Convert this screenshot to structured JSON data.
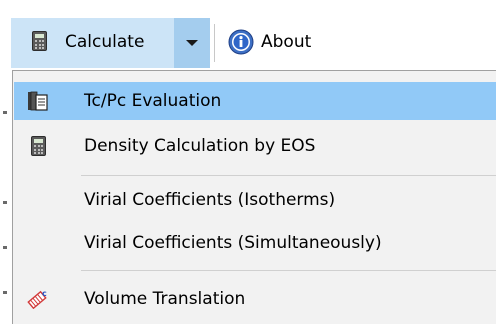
{
  "toolbar": {
    "calculate_label": "Calculate",
    "about_label": "About",
    "calculate_icon": "calculator-icon",
    "dropdown_icon": "chevron-down-icon",
    "about_icon": "info-icon"
  },
  "menu": {
    "items": [
      {
        "label": "Tc/Pc Evaluation",
        "icon": "copy-pages-icon",
        "highlighted": true
      },
      {
        "label": "Density Calculation by EOS",
        "icon": "calculator-icon",
        "highlighted": false
      },
      {
        "label": "Virial Coefficients (Isotherms)",
        "icon": "",
        "highlighted": false
      },
      {
        "label": "Virial Coefficients (Simultaneously)",
        "icon": "",
        "highlighted": false
      },
      {
        "label": "Volume Translation",
        "icon": "volume-translation-icon",
        "highlighted": false
      }
    ]
  },
  "colors": {
    "highlight": "#91c9f7",
    "button_hover": "#cce4f7",
    "arrow_pressed": "#a4cdee",
    "menu_bg": "#f2f2f2"
  }
}
